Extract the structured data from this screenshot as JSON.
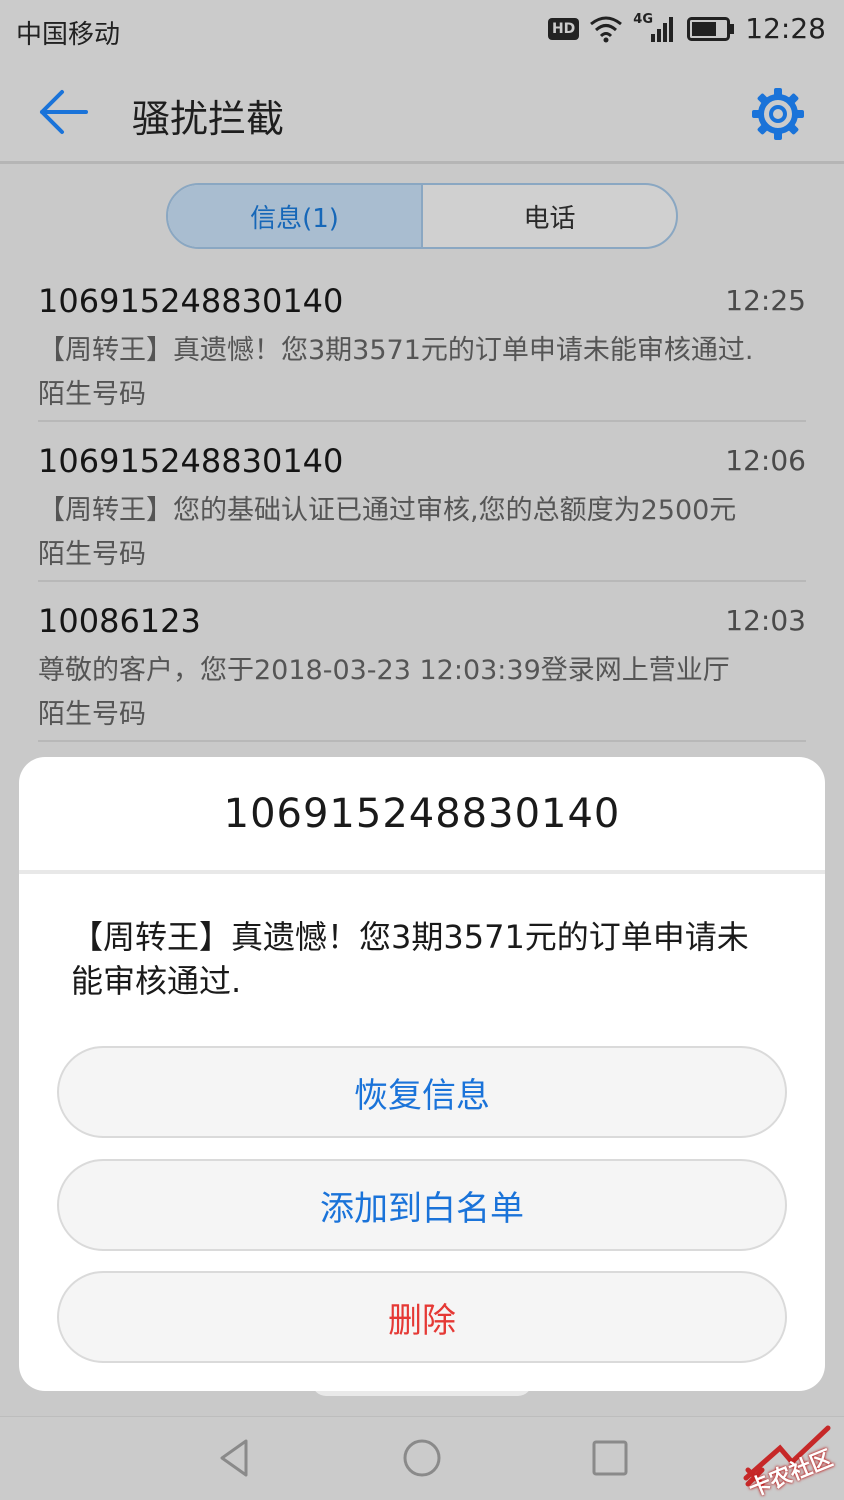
{
  "status_bar": {
    "carrier": "中国移动",
    "hd_badge": "HD",
    "network": "4G",
    "time": "12:28"
  },
  "app_bar": {
    "title": "骚扰拦截",
    "back_icon": "arrow-left-icon",
    "settings_icon": "gear-icon"
  },
  "tabs": [
    {
      "label": "信息(1)",
      "active": true
    },
    {
      "label": "电话",
      "active": false
    }
  ],
  "messages": [
    {
      "number": "106915248830140",
      "time": "12:25",
      "preview": "【周转王】真遗憾！您3期3571元的订单申请未能审核通过.",
      "tag": "陌生号码"
    },
    {
      "number": "106915248830140",
      "time": "12:06",
      "preview": "【周转王】您的基础认证已通过审核,您的总额度为2500元",
      "tag": "陌生号码"
    },
    {
      "number": "10086123",
      "time": "12:03",
      "preview": "尊敬的客户，您于2018-03-23 12:03:39登录网上营业厅",
      "tag": "陌生号码"
    }
  ],
  "dialog": {
    "title": "106915248830140",
    "message": "【周转王】真遗憾！您3期3571元的订单申请未能审核通过.",
    "buttons": {
      "restore": "恢复信息",
      "whitelist": "添加到白名单",
      "delete": "删除"
    }
  },
  "colors": {
    "accent": "#1a73d9",
    "danger": "#e53935",
    "overlay": "#c9c9c9"
  },
  "watermark": {
    "text": "卡农社区"
  }
}
